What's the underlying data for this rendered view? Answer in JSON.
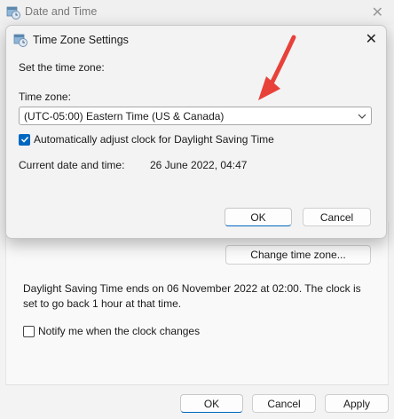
{
  "background_window": {
    "title": "Date and Time",
    "close_glyph": "✕",
    "change_tz_button": "Change time zone...",
    "dst_info": "Daylight Saving Time ends on 06 November 2022 at 02:00. The clock is set to go back 1 hour at that time.",
    "notify_label": "Notify me when the clock changes",
    "ok_button": "OK",
    "cancel_button": "Cancel",
    "apply_button": "Apply"
  },
  "dialog": {
    "title": "Time Zone Settings",
    "close_glyph": "✕",
    "set_tz_label": "Set the time zone:",
    "tz_label": "Time zone:",
    "tz_value": "(UTC-05:00) Eastern Time (US & Canada)",
    "auto_dst_label": "Automatically adjust clock for Daylight Saving Time",
    "auto_dst_checked": true,
    "current_label": "Current date and time:",
    "current_value": "26 June 2022, 04:47",
    "ok_button": "OK",
    "cancel_button": "Cancel"
  },
  "icons": {
    "window_icon": "clock-calendar-icon",
    "dropdown": "chevron-down-icon",
    "annotation": "red-arrow"
  },
  "colors": {
    "accent": "#0067c0",
    "annotation_arrow": "#e8413a"
  }
}
